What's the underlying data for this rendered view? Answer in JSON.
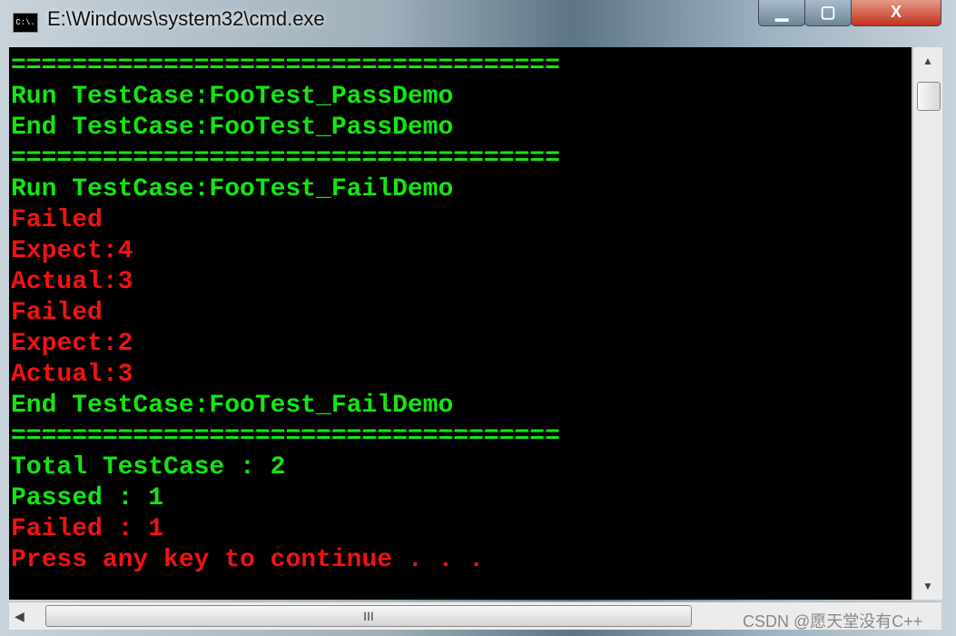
{
  "window": {
    "title": "E:\\Windows\\system32\\cmd.exe",
    "icon_text": "C:\\.",
    "minimize": "▁",
    "maximize": "▢",
    "close": "X"
  },
  "console": {
    "lines": [
      {
        "text": "====================================",
        "color": "green"
      },
      {
        "text": "Run TestCase:FooTest_PassDemo",
        "color": "green"
      },
      {
        "text": "End TestCase:FooTest_PassDemo",
        "color": "green"
      },
      {
        "text": "====================================",
        "color": "green"
      },
      {
        "text": "Run TestCase:FooTest_FailDemo",
        "color": "green"
      },
      {
        "text": "Failed",
        "color": "red"
      },
      {
        "text": "Expect:4",
        "color": "red"
      },
      {
        "text": "Actual:3",
        "color": "red"
      },
      {
        "text": "Failed",
        "color": "red"
      },
      {
        "text": "Expect:2",
        "color": "red"
      },
      {
        "text": "Actual:3",
        "color": "red"
      },
      {
        "text": "End TestCase:FooTest_FailDemo",
        "color": "green"
      },
      {
        "text": "====================================",
        "color": "green"
      },
      {
        "text": "Total TestCase : 2",
        "color": "green"
      },
      {
        "text": "Passed : 1",
        "color": "green"
      },
      {
        "text": "Failed : 1",
        "color": "red"
      },
      {
        "text": "Press any key to continue . . .",
        "color": "red"
      }
    ]
  },
  "colors": {
    "green": "#13e613",
    "red": "#f01313",
    "background": "#000000"
  },
  "scrollbar": {
    "up": "▲",
    "down": "▼",
    "left": "◀",
    "grip": "III"
  },
  "watermark": "CSDN @愿天堂没有C++"
}
